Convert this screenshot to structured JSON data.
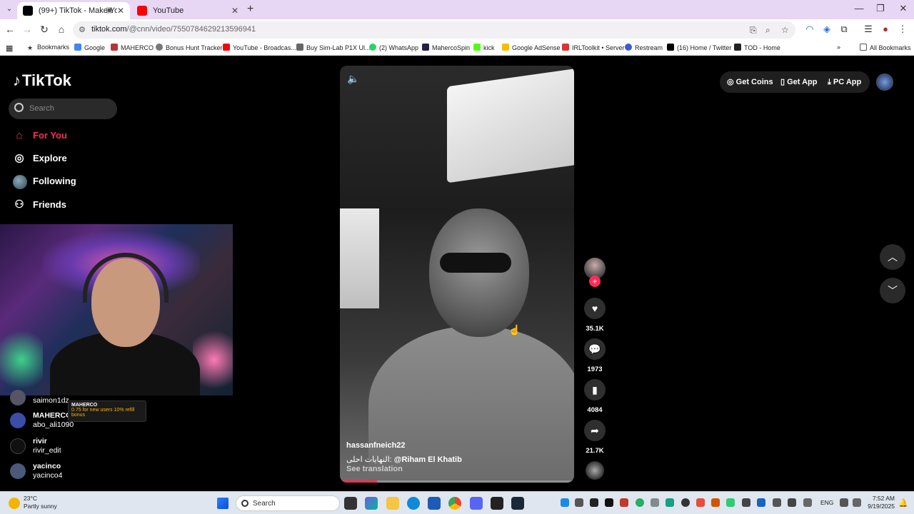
{
  "browser": {
    "tabs": [
      {
        "title": "(99+) TikTok - Make Your D",
        "active": true
      },
      {
        "title": "YouTube",
        "active": false
      }
    ],
    "url_host": "tiktok.com",
    "url_path": "/@cnn/video/7550784629213596941",
    "bookmarks": [
      {
        "label": "Bookmarks",
        "icon": "star-icon"
      },
      {
        "label": "Google",
        "icon": "google-icon"
      },
      {
        "label": "MAHERCO",
        "icon": "maherco-icon"
      },
      {
        "label": "Bonus Hunt Tracker",
        "icon": "tracker-icon"
      },
      {
        "label": "YouTube - Broadcas...",
        "icon": "youtube-icon"
      },
      {
        "label": "Buy Sim-Lab P1X Ul...",
        "icon": "simlab-icon"
      },
      {
        "label": "(2) WhatsApp",
        "icon": "whatsapp-icon"
      },
      {
        "label": "MahercoSpin",
        "icon": "mahercospin-icon"
      },
      {
        "label": "kick",
        "icon": "kick-icon"
      },
      {
        "label": "Google AdSense",
        "icon": "adsense-icon"
      },
      {
        "label": "IRLToolkit • Server",
        "icon": "irltoolkit-icon"
      },
      {
        "label": "Restream",
        "icon": "restream-icon"
      },
      {
        "label": "(16) Home / Twitter",
        "icon": "x-icon"
      },
      {
        "label": "TOD - Home",
        "icon": "tod-icon"
      }
    ],
    "more_bookmarks": "»",
    "all_bookmarks": "All Bookmarks"
  },
  "tiktok": {
    "logo": "TikTok",
    "search_placeholder": "Search",
    "nav": [
      {
        "label": "For You",
        "icon": "home-icon",
        "active": true
      },
      {
        "label": "Explore",
        "icon": "compass-icon",
        "active": false
      },
      {
        "label": "Following",
        "icon": "avatar",
        "active": false
      },
      {
        "label": "Friends",
        "icon": "friends-icon",
        "active": false
      }
    ],
    "header": {
      "get_coins": "Get Coins",
      "get_app": "Get App",
      "pc_app": "PC App"
    },
    "video": {
      "username": "hassanfneich22",
      "caption_prefix": "النهايات احلى: ",
      "caption_mention": "@Riham El Khatib",
      "see_translation": "See translation",
      "progress": 0.16
    },
    "actions": {
      "likes": "35.1K",
      "comments": "1973",
      "saves": "4084",
      "shares": "21.7K"
    }
  },
  "stream_overlay": {
    "chat": [
      {
        "name": "",
        "user": "saimon1dz"
      },
      {
        "name": "MAHERCO",
        "user": "abo_ali1090"
      },
      {
        "name": "rivir",
        "user": "rivir_edit"
      },
      {
        "name": "yacinco",
        "user": "yacinco4"
      }
    ],
    "promo_brand": "MAHERCO",
    "promo_text": "0.75 for new users 10% refill bonus"
  },
  "taskbar": {
    "temperature": "23°C",
    "weather": "Partly sunny",
    "search_placeholder": "Search",
    "language": "ENG",
    "time": "7:52 AM",
    "date": "9/19/2025"
  }
}
